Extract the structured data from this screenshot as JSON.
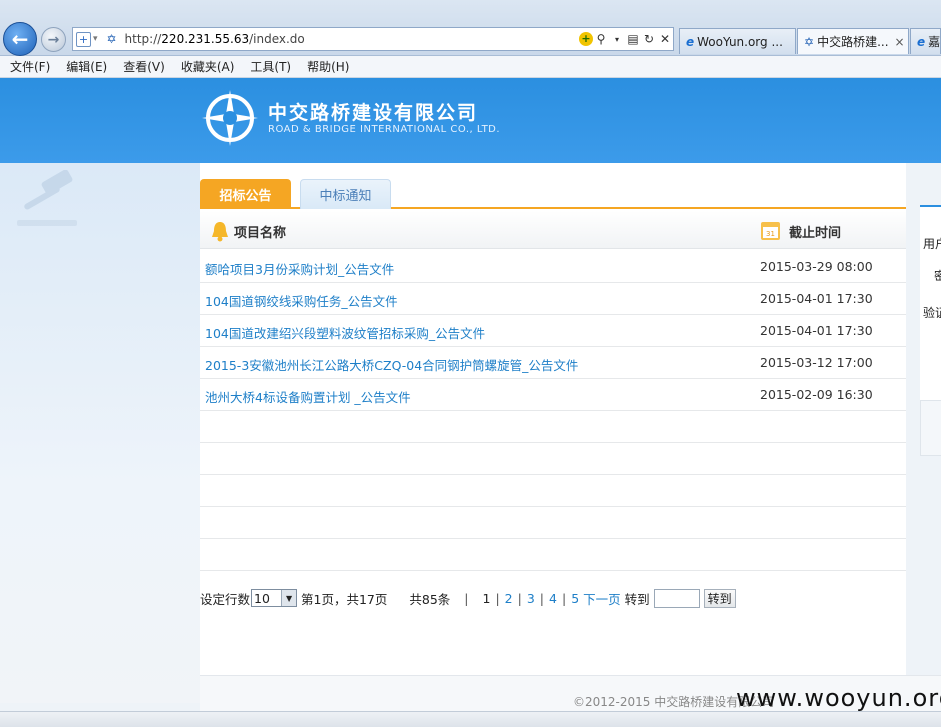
{
  "browser": {
    "address_url_prefix": "http://",
    "address_url_host": "220.231.55.63",
    "address_url_path": "/index.do",
    "tabs": [
      {
        "label": "WooYun.org ...",
        "close": ""
      },
      {
        "label": "中交路桥建...",
        "close": "×"
      },
      {
        "label": "嘉",
        "close": ""
      }
    ],
    "menu": [
      "文件(F)",
      "编辑(E)",
      "查看(V)",
      "收藏夹(A)",
      "工具(T)",
      "帮助(H)"
    ]
  },
  "site": {
    "name_cn": "中交路桥建设有限公司",
    "name_en": "ROAD & BRIDGE INTERNATIONAL CO., LTD."
  },
  "tabs": {
    "notice": "招标公告",
    "award": "中标通知"
  },
  "table": {
    "col_name": "项目名称",
    "col_time": "截止时间",
    "rows": [
      {
        "name": "额哈项目3月份采购计划_公告文件",
        "time": "2015-03-29 08:00"
      },
      {
        "name": "104国道钢绞线采购任务_公告文件",
        "time": "2015-04-01 17:30"
      },
      {
        "name": "104国道改建绍兴段塑料波纹管招标采购_公告文件",
        "time": "2015-04-01 17:30"
      },
      {
        "name": "2015-3安徽池州长江公路大桥CZQ-04合同钢护筒螺旋管_公告文件",
        "time": "2015-03-12 17:00"
      },
      {
        "name": "池州大桥4标设备购置计划 _公告文件",
        "time": "2015-02-09 16:30"
      }
    ]
  },
  "pager": {
    "rows_label": "设定行数",
    "rows_value": "10",
    "page_info": "第1页，共17页",
    "total": "共85条",
    "pages": [
      "1",
      "2",
      "3",
      "4",
      "5"
    ],
    "next": "下一页",
    "goto_label": "转到",
    "goto_button": "转到"
  },
  "right_panel": {
    "user_label": "用户",
    "pwd_label": "密",
    "captcha_label": "验证"
  },
  "footer": {
    "copyright": "©2012-2015 中交路桥建设有限公司"
  },
  "watermark": "www.wooyun.org"
}
